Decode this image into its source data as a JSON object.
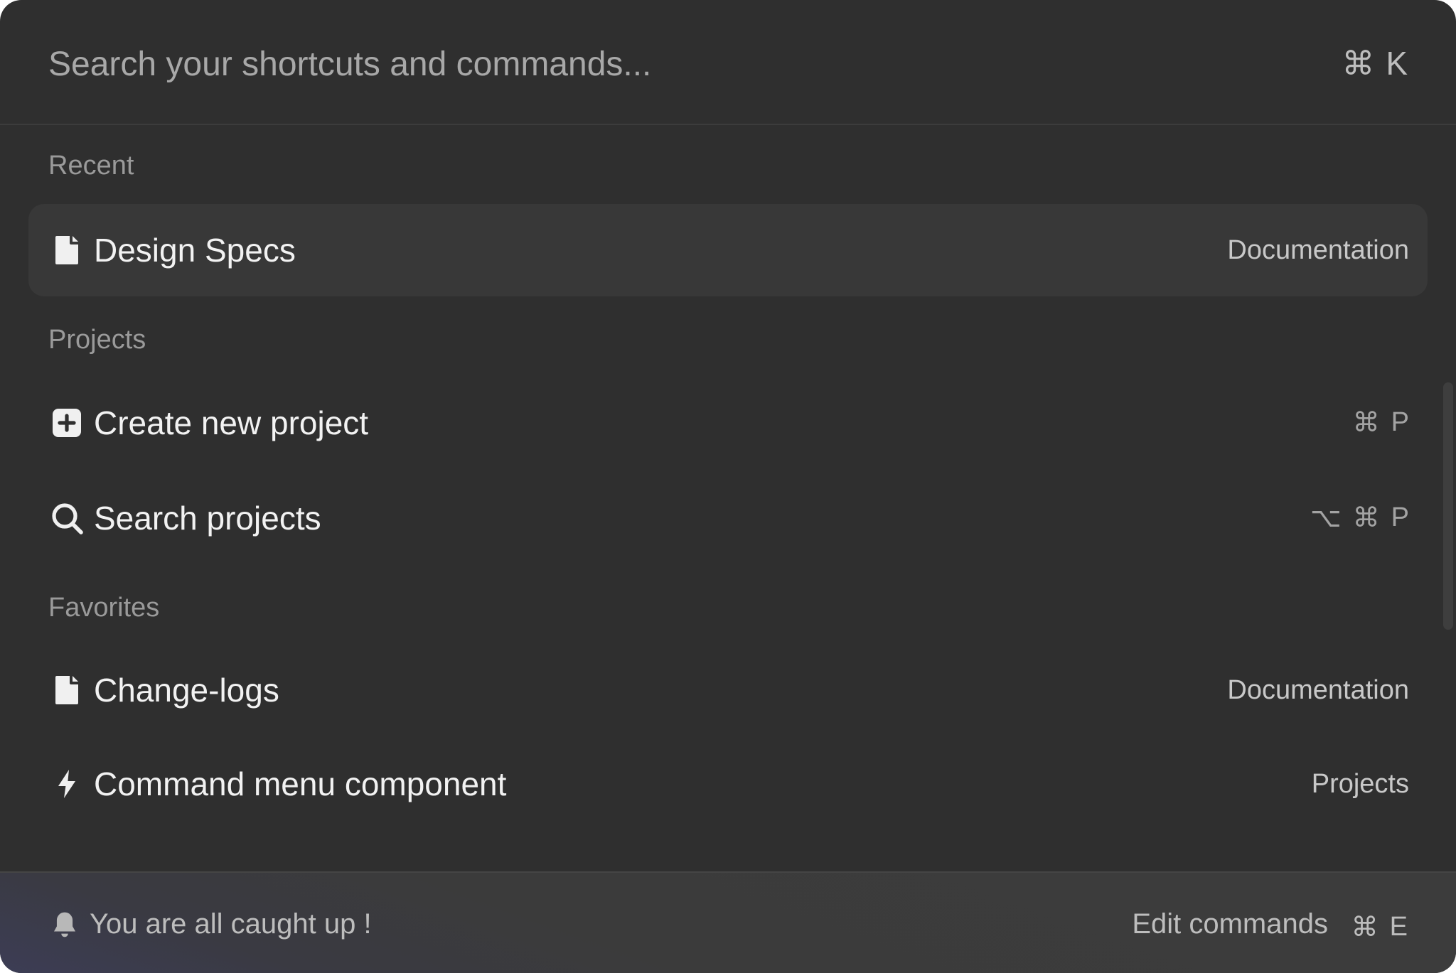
{
  "search": {
    "placeholder": "Search your shortcuts and commands...",
    "shortcut": [
      "⌘",
      "K"
    ]
  },
  "sections": {
    "recent": "Recent",
    "projects": "Projects",
    "favorites": "Favorites"
  },
  "items": {
    "design_specs": {
      "label": "Design Specs",
      "meta": "Documentation",
      "icon": "document-icon"
    },
    "create_project": {
      "label": "Create new project",
      "shortcut": [
        "⌘",
        "P"
      ],
      "icon": "plus-square-icon"
    },
    "search_projects": {
      "label": "Search projects",
      "shortcut": [
        "⌥",
        "⌘",
        "P"
      ],
      "icon": "search-icon"
    },
    "change_logs": {
      "label": "Change-logs",
      "meta": "Documentation",
      "icon": "document-icon"
    },
    "command_menu": {
      "label": "Command menu component",
      "meta": "Projects",
      "icon": "lightning-icon"
    }
  },
  "footer": {
    "status": "You are all caught up !",
    "edit_label": "Edit commands",
    "edit_shortcut": [
      "⌘",
      "E"
    ],
    "icon": "bell-icon"
  },
  "colors": {
    "background": "#2f2f2f",
    "active_item": "#383838",
    "footer": "#3c3c3c",
    "text": "#f2f2f2",
    "muted": "#9a9a9a"
  }
}
